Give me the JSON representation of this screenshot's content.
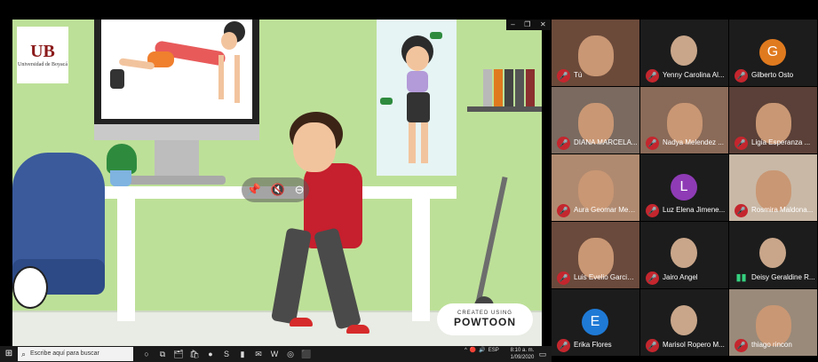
{
  "window": {
    "controls": [
      "–",
      "❐",
      "✕"
    ]
  },
  "presentation": {
    "logo_mark": "UB",
    "logo_text": "Universidad de Boyacá",
    "pin_controls": [
      "📌",
      "🔇",
      "⊖"
    ],
    "powtoon_small": "CREATED USING",
    "powtoon_big": "POWTOON"
  },
  "participants": [
    {
      "name": "Tú",
      "type": "video",
      "bg": "#6b4a3a",
      "muted": true
    },
    {
      "name": "Yenny Carolina Al...",
      "type": "photo",
      "bg": "#1c1c1c",
      "muted": true
    },
    {
      "name": "Gilberto Osto",
      "type": "letter",
      "letter": "G",
      "color": "#e07a1f",
      "bg": "#1c1c1c",
      "muted": true
    },
    {
      "name": "DIANA MARCELA...",
      "type": "video",
      "bg": "#7a6a60",
      "muted": true
    },
    {
      "name": "Nadya Melendez ...",
      "type": "video",
      "bg": "#8a6a58",
      "muted": true
    },
    {
      "name": "Ligia Esperanza ...",
      "type": "video",
      "bg": "#5a4038",
      "muted": true
    },
    {
      "name": "Aura Geomar Med...",
      "type": "video",
      "bg": "#b08a70",
      "muted": true
    },
    {
      "name": "Luz Elena Jimene...",
      "type": "letter",
      "letter": "L",
      "color": "#8e3bb5",
      "bg": "#1c1c1c",
      "muted": true
    },
    {
      "name": "Rosmira Maldona...",
      "type": "video",
      "bg": "#c9b8a6",
      "muted": true
    },
    {
      "name": "Luis Evelio Garcia ...",
      "type": "video",
      "bg": "#6a4a3c",
      "muted": true
    },
    {
      "name": "Jairo Angel",
      "type": "photo",
      "bg": "#1c1c1c",
      "muted": true
    },
    {
      "name": "Deisy Geraldine R...",
      "type": "photo",
      "bg": "#1c1c1c",
      "muted": false,
      "active": true
    },
    {
      "name": "Erika Flores",
      "type": "letter",
      "letter": "E",
      "color": "#1f7ad6",
      "bg": "#1c1c1c",
      "muted": true
    },
    {
      "name": "Marisol Ropero M...",
      "type": "photo",
      "bg": "#1c1c1c",
      "muted": true
    },
    {
      "name": "thiago rincon",
      "type": "video",
      "bg": "#9a8a7a",
      "muted": true
    }
  ],
  "taskbar": {
    "search_placeholder": "Escribe aquí para buscar",
    "icons": [
      "○",
      "⧉",
      "🗂",
      "🛍",
      "●",
      "S",
      "▮",
      "✉",
      "W",
      "◎",
      "⬛"
    ],
    "tray": [
      "^",
      "🔴",
      "🔊",
      "ESP"
    ],
    "time": "8:10 a. m.",
    "date": "1/09/2020"
  }
}
